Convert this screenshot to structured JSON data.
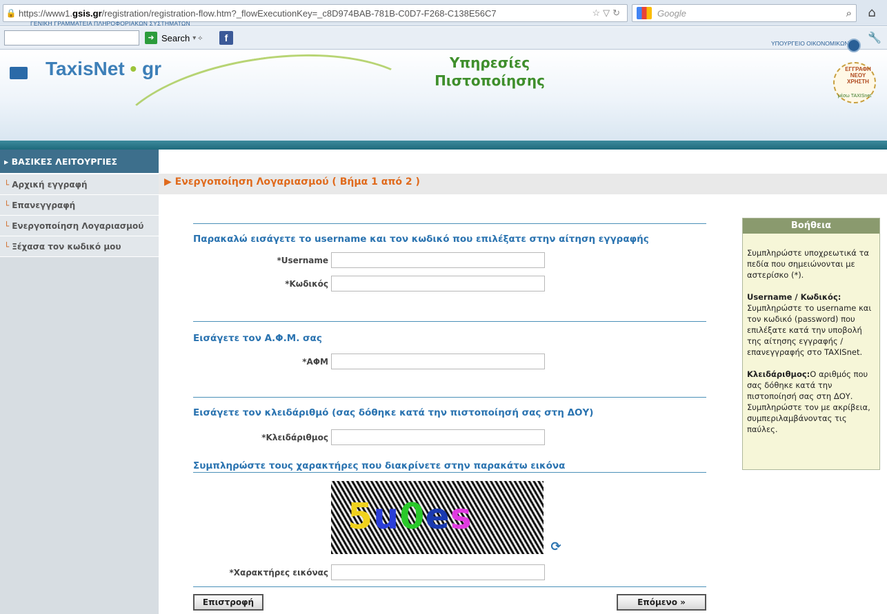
{
  "browser": {
    "url_prefix": "https://www1.",
    "url_host": "gsis.gr",
    "url_rest": "/registration/registration-flow.htm?_flowExecutionKey=_c8D974BAB-781B-C0D7-F268-C138E56C7",
    "search_engine_label": "Google",
    "toolbar_search_label": "Search"
  },
  "banner": {
    "gsis_text": "ΓΕΝΙΚΗ ΓΡΑΜΜΑΤΕΙΑ ΠΛΗΡΟΦΟΡΙΑΚΩΝ ΣΥΣΤΗΜΑΤΩΝ",
    "taxisnet_logo": "TaxisNet",
    "taxisnet_logo_suffix": "gr",
    "title_line1": "Υπηρεσίες",
    "title_line2": "Πιστοποίησης",
    "ministry": "ΥΠΟΥΡΓΕΙΟ ΟΙΚΟΝΟΜΙΚΩΝ",
    "badge_ring": "ΕΓΓΡΑΦΗ ΝΕΟΥ ΧΡΗΣΤΗ",
    "badge_sub": "μέσω TAXISnet"
  },
  "nav": {
    "header": "ΒΑΣΙΚΕΣ ΛΕΙΤΟΥΡΓΙΕΣ",
    "items": [
      {
        "label": "Αρχική εγγραφή"
      },
      {
        "label": "Επανεγγραφή"
      },
      {
        "label": "Ενεργοποίηση Λογαριασμού"
      },
      {
        "label": "Ξέχασα τον κωδικό μου"
      }
    ]
  },
  "main": {
    "step_title": "Ενεργοποίηση Λογαριασμού ( Βήμα 1 από 2 )",
    "sections": [
      {
        "title": "Παρακαλώ εισάγετε το username και τον κωδικό που επιλέξατε στην αίτηση εγγραφής"
      },
      {
        "title": "Εισάγετε τον Α.Φ.Μ. σας"
      },
      {
        "title": "Εισάγετε τον κλειδάριθμό (σας δόθηκε κατά την πιστοποίησή σας στη ΔΟΥ)"
      },
      {
        "title": "Συμπληρώστε τους χαρακτήρες που διακρίνετε στην παρακάτω εικόνα"
      }
    ],
    "fields": {
      "username_label": "*Username",
      "password_label": "*Κωδικός",
      "afm_label": "*ΑΦΜ",
      "keynumber_label": "*Κλειδάριθμος",
      "captcha_label": "*Χαρακτήρες εικόνας",
      "username_value": "",
      "password_value": "",
      "afm_value": "",
      "keynumber_value": "",
      "captcha_value": ""
    },
    "captcha_chars": [
      "5",
      "u",
      "0",
      "e",
      "s"
    ],
    "back_button": "Επιστροφή",
    "next_button": "Επόμενο »"
  },
  "help": {
    "title": "Βοήθεια",
    "p1": "Συμπληρώστε υποχρεωτικά τα πεδία που σημειώνονται με αστερίσκο (*).",
    "p2_title": "Username / Κωδικός:",
    "p2_body": "Συμπληρώστε το username και τον κωδικό (password) που επιλέξατε κατά την υποβολή της αίτησης εγγραφής / επανεγγραφής στο TAXISnet.",
    "p3_title": "Κλειδάριθμος:",
    "p3_body": "Ο αριθμός που σας δόθηκε κατά την πιστοποίησή σας στη ΔΟΥ. Συμπληρώστε τον με ακρίβεια, συμπεριλαμβάνοντας τις παύλες."
  }
}
